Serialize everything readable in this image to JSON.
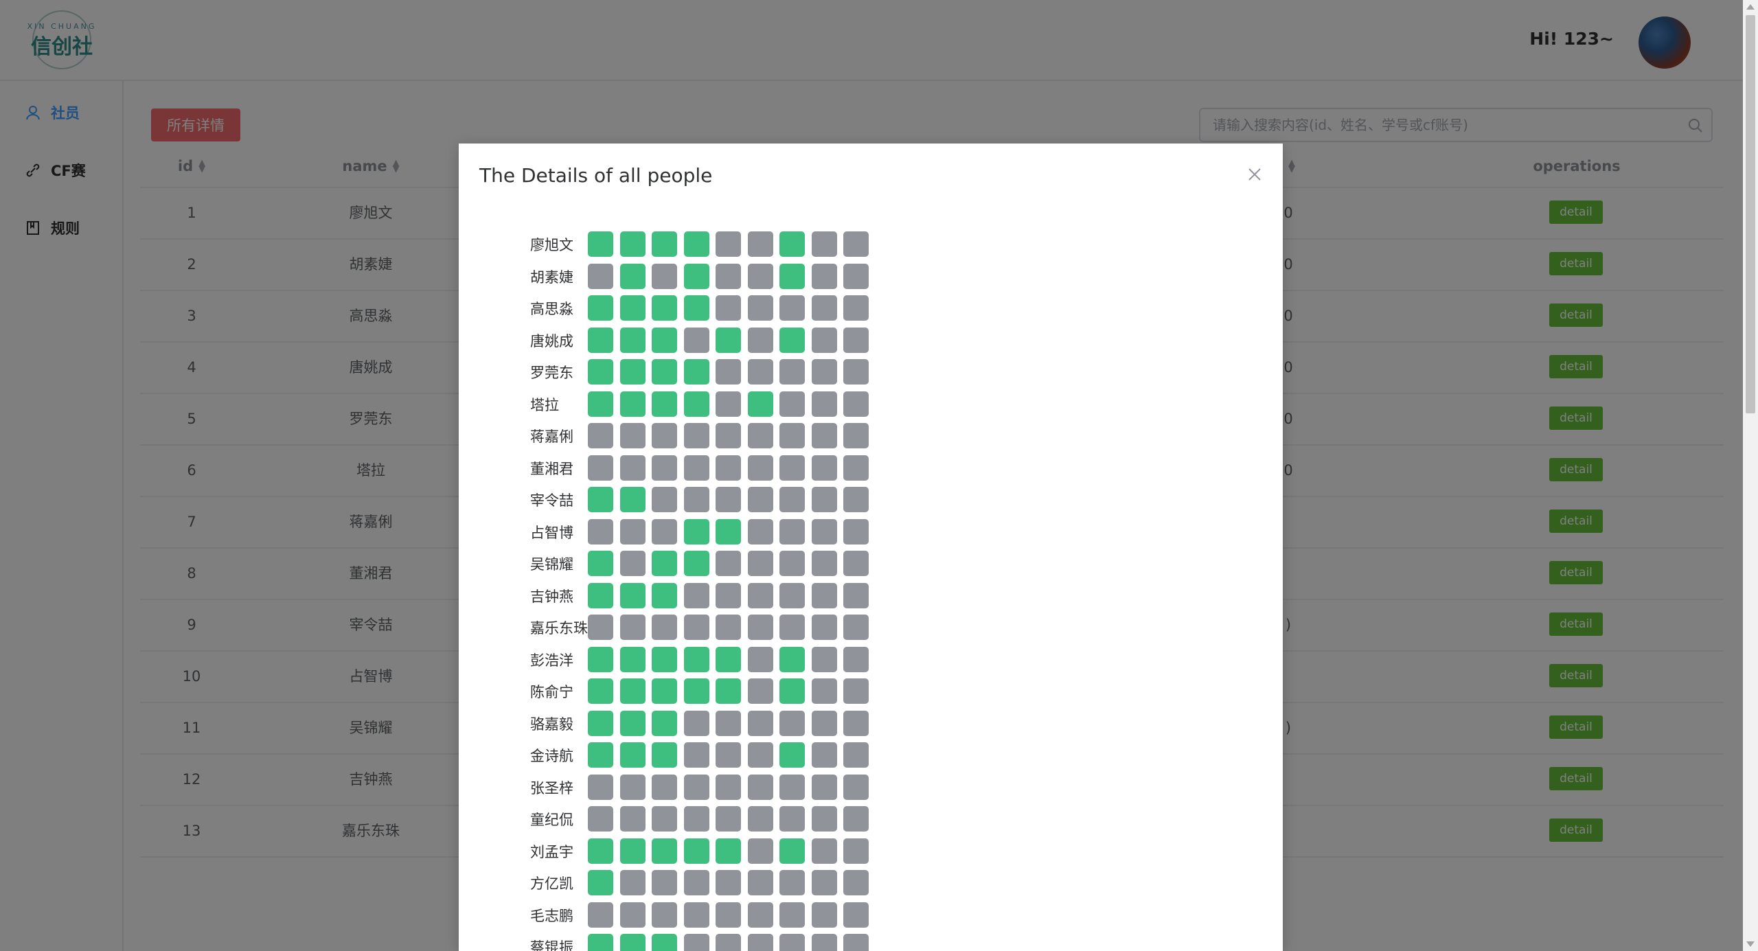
{
  "header": {
    "logo_top_text": "XIN CHUANG",
    "logo_text": "信创社",
    "greeting": "Hi! 123~"
  },
  "sidebar": {
    "items": [
      {
        "label": "社员",
        "icon": "user-icon",
        "active": true
      },
      {
        "label": "CF赛",
        "icon": "link-icon",
        "active": false
      },
      {
        "label": "规则",
        "icon": "book-icon",
        "active": false
      }
    ]
  },
  "toolbar": {
    "all_details_label": "所有详情",
    "search_placeholder": "请输入搜索内容(id、姓名、学号或cf账号)"
  },
  "table": {
    "headers": {
      "id": "id",
      "name": "name",
      "operations": "operations"
    },
    "detail_label": "detail",
    "rows": [
      {
        "id": "1",
        "name": "廖旭文",
        "partial": "0"
      },
      {
        "id": "2",
        "name": "胡素婕",
        "partial": "0"
      },
      {
        "id": "3",
        "name": "高思淼",
        "partial": "0"
      },
      {
        "id": "4",
        "name": "唐姚成",
        "partial": "0"
      },
      {
        "id": "5",
        "name": "罗莞东",
        "partial": "0"
      },
      {
        "id": "6",
        "name": "塔拉",
        "partial": "0"
      },
      {
        "id": "7",
        "name": "蒋嘉俐",
        "partial": ""
      },
      {
        "id": "8",
        "name": "董湘君",
        "partial": ""
      },
      {
        "id": "9",
        "name": "宰令喆",
        "partial": ")"
      },
      {
        "id": "10",
        "name": "占智博",
        "partial": ""
      },
      {
        "id": "11",
        "name": "吴锦耀",
        "partial": ")"
      },
      {
        "id": "12",
        "name": "吉钟燕",
        "partial": ""
      },
      {
        "id": "13",
        "name": "嘉乐东珠",
        "partial": ""
      }
    ]
  },
  "dialog": {
    "title": "The Details of all people",
    "colors": {
      "on": "#3ebf7f",
      "off": "#909399"
    },
    "people": [
      {
        "name": "廖旭文",
        "cells": [
          1,
          1,
          1,
          1,
          0,
          0,
          1,
          0,
          0
        ]
      },
      {
        "name": "胡素婕",
        "cells": [
          0,
          1,
          0,
          1,
          0,
          0,
          1,
          0,
          0
        ]
      },
      {
        "name": "高思淼",
        "cells": [
          1,
          1,
          1,
          1,
          0,
          0,
          0,
          0,
          0
        ]
      },
      {
        "name": "唐姚成",
        "cells": [
          1,
          1,
          1,
          0,
          1,
          0,
          1,
          0,
          0
        ]
      },
      {
        "name": "罗莞东",
        "cells": [
          1,
          1,
          1,
          1,
          0,
          0,
          0,
          0,
          0
        ]
      },
      {
        "name": "塔拉",
        "cells": [
          1,
          1,
          1,
          1,
          0,
          1,
          0,
          0,
          0
        ]
      },
      {
        "name": "蒋嘉俐",
        "cells": [
          0,
          0,
          0,
          0,
          0,
          0,
          0,
          0,
          0
        ]
      },
      {
        "name": "董湘君",
        "cells": [
          0,
          0,
          0,
          0,
          0,
          0,
          0,
          0,
          0
        ]
      },
      {
        "name": "宰令喆",
        "cells": [
          1,
          1,
          0,
          0,
          0,
          0,
          0,
          0,
          0
        ]
      },
      {
        "name": "占智博",
        "cells": [
          0,
          0,
          0,
          1,
          1,
          0,
          0,
          0,
          0
        ]
      },
      {
        "name": "吴锦耀",
        "cells": [
          1,
          0,
          1,
          1,
          0,
          0,
          0,
          0,
          0
        ]
      },
      {
        "name": "吉钟燕",
        "cells": [
          1,
          1,
          1,
          0,
          0,
          0,
          0,
          0,
          0
        ]
      },
      {
        "name": "嘉乐东珠",
        "cells": [
          0,
          0,
          0,
          0,
          0,
          0,
          0,
          0,
          0
        ]
      },
      {
        "name": "彭浩洋",
        "cells": [
          1,
          1,
          1,
          1,
          1,
          0,
          1,
          0,
          0
        ]
      },
      {
        "name": "陈俞宁",
        "cells": [
          1,
          1,
          1,
          1,
          1,
          0,
          1,
          0,
          0
        ]
      },
      {
        "name": "骆嘉毅",
        "cells": [
          1,
          1,
          1,
          0,
          0,
          0,
          0,
          0,
          0
        ]
      },
      {
        "name": "金诗航",
        "cells": [
          1,
          1,
          1,
          0,
          0,
          0,
          1,
          0,
          0
        ]
      },
      {
        "name": "张圣梓",
        "cells": [
          0,
          0,
          0,
          0,
          0,
          0,
          0,
          0,
          0
        ]
      },
      {
        "name": "童纪侃",
        "cells": [
          0,
          0,
          0,
          0,
          0,
          0,
          0,
          0,
          0
        ]
      },
      {
        "name": "刘孟宇",
        "cells": [
          1,
          1,
          1,
          1,
          1,
          0,
          1,
          0,
          0
        ]
      },
      {
        "name": "方亿凯",
        "cells": [
          1,
          0,
          0,
          0,
          0,
          0,
          0,
          0,
          0
        ]
      },
      {
        "name": "毛志鹏",
        "cells": [
          0,
          0,
          0,
          0,
          0,
          0,
          0,
          0,
          0
        ]
      },
      {
        "name": "蔡锟振",
        "cells": [
          1,
          1,
          1,
          0,
          0,
          0,
          0,
          0,
          0
        ]
      }
    ]
  }
}
